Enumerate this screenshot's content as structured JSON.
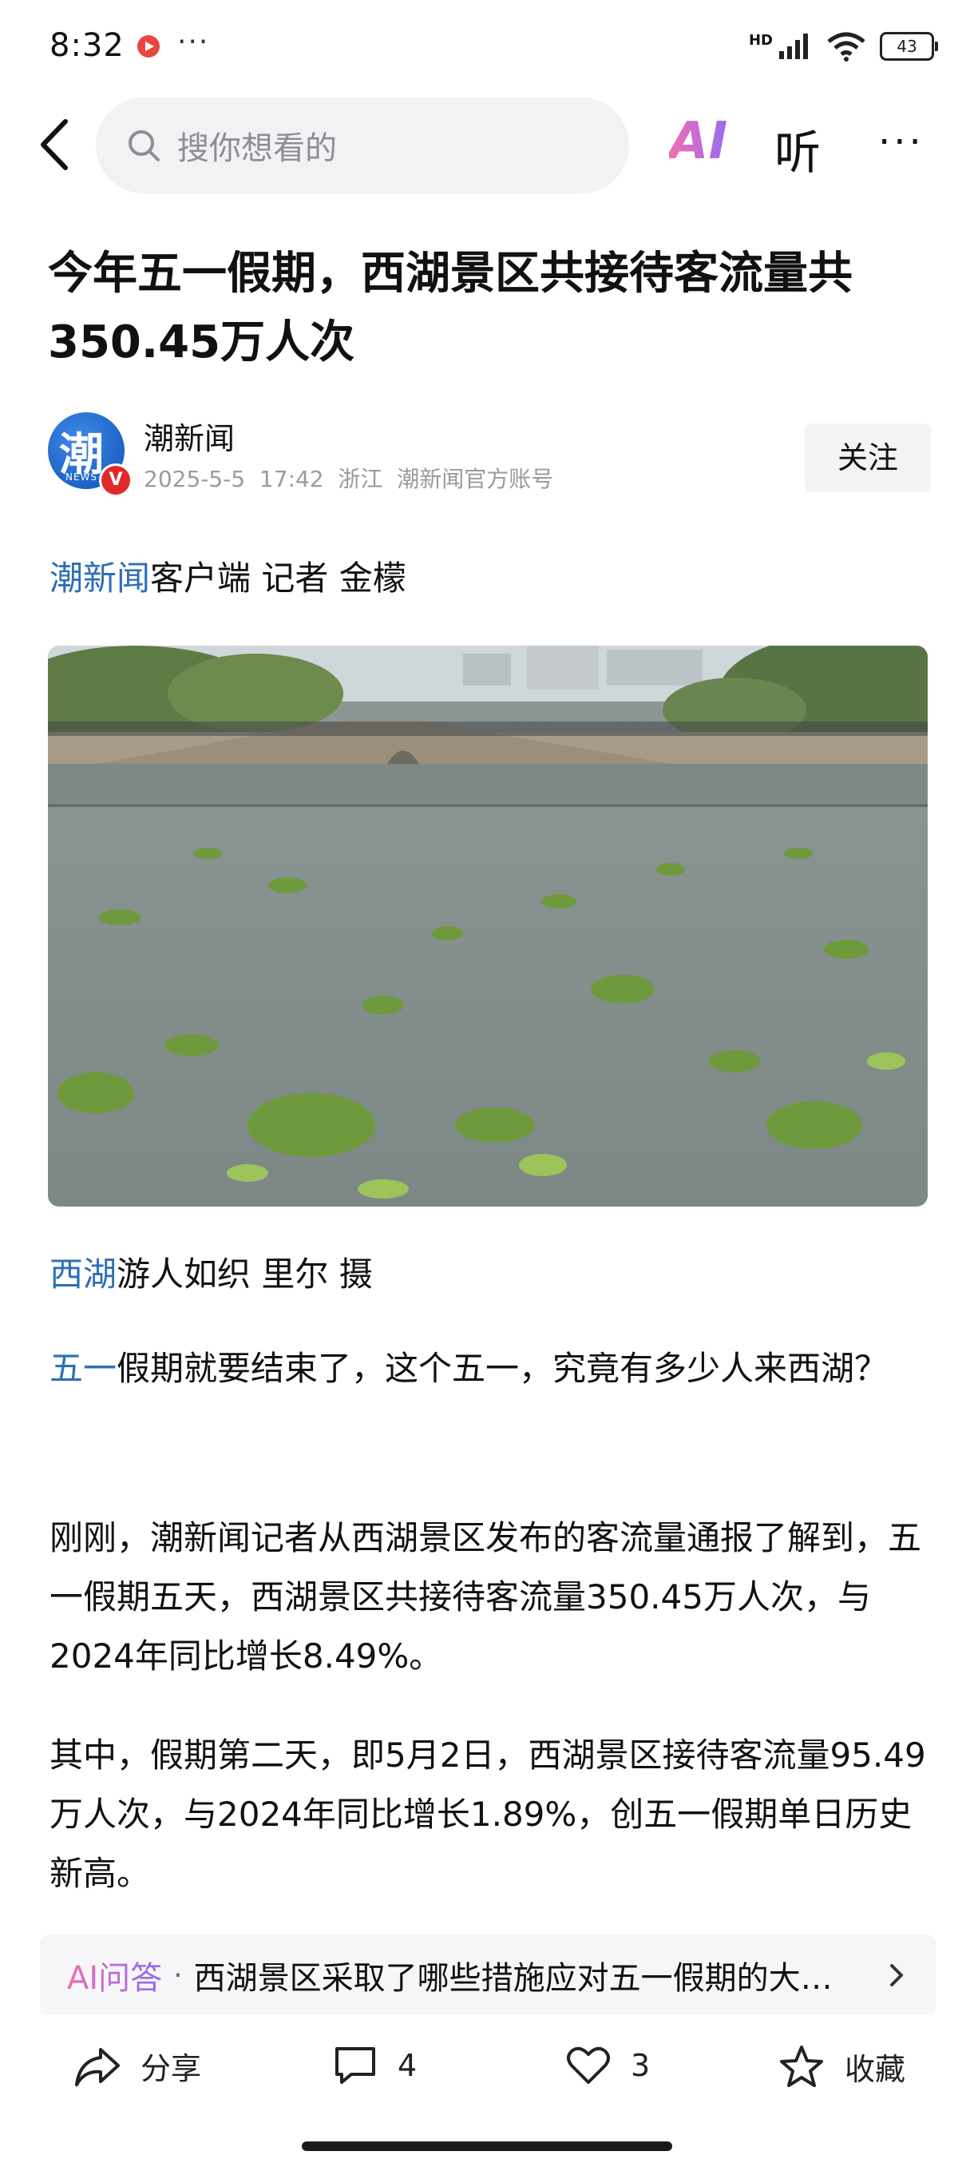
{
  "status_bar": {
    "time": "8:32",
    "more": "···",
    "network": "HD",
    "battery": "43"
  },
  "search": {
    "placeholder": "搜你想看的"
  },
  "nav": {
    "ai_label": "AI",
    "listen_label": "听",
    "more_label": "···"
  },
  "article": {
    "title": "今年五一假期，西湖景区共接待客流量共350.45万人次",
    "author": {
      "name": "潮新闻",
      "avatar_char": "潮",
      "avatar_sub": "NEWS",
      "verified_mark": "V",
      "date": "2025-5-5",
      "time": "17:42",
      "region": "浙江",
      "account_type": "潮新闻官方账号"
    },
    "follow_label": "关注",
    "byline_link": "潮新闻",
    "byline_rest": "客户端 记者 金檬",
    "caption_link": "西湖",
    "caption_rest": "游人如织 里尔 摄",
    "p1_link": "五一",
    "p1_rest": "假期就要结束了，这个五一，究竟有多少人来西湖？",
    "p2": "刚刚，潮新闻记者从西湖景区发布的客流量通报了解到，五一假期五天，西湖景区共接待客流量350.45万人次，与2024年同比增长8.49%。",
    "p3": "其中，假期第二天，即5月2日，西湖景区接待客流量95.49万人次，与2024年同比增长1.89%，创五一假期单日历史新高。"
  },
  "ai_answer": {
    "label": "AI问答",
    "separator": "·",
    "question": "西湖景区采取了哪些措施应对五一假期的大…"
  },
  "toolbar": {
    "share_label": "分享",
    "comment_count": "4",
    "like_count": "3",
    "fav_label": "收藏"
  }
}
